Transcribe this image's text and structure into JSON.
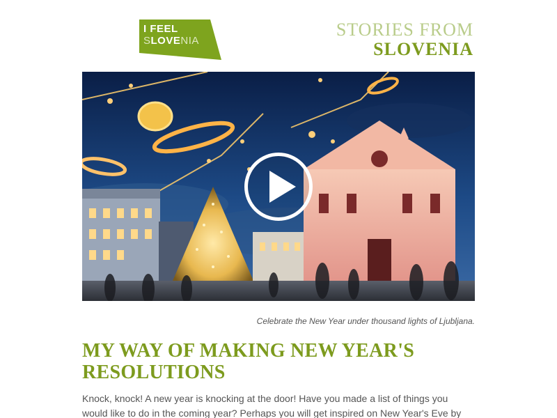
{
  "header": {
    "logo": {
      "line1": "I FEEL",
      "line2_prefix": "S",
      "line2_highlight": "LOVE",
      "line2_suffix": "NIA",
      "background_color": "#7ea41e"
    },
    "stories_line1": "STORIES FROM",
    "stories_line2": "SLOVENIA"
  },
  "hero": {
    "image_alt": "Christmas lights over Prešeren Square in Ljubljana at dusk",
    "play_icon": "play-icon"
  },
  "caption": "Celebrate the New Year under thousand lights of Ljubljana.",
  "article": {
    "title": "MY WAY OF MAKING NEW YEAR'S RESOLUTIONS",
    "body": "Knock, knock! A new year is knocking at the door! Have you made a list of things you would like to do in the coming year? Perhaps you will get inspired on New Year's Eve by"
  },
  "colors": {
    "accent_green": "#7d9b1e",
    "light_green": "#b9cc8a",
    "text_gray": "#555555"
  }
}
